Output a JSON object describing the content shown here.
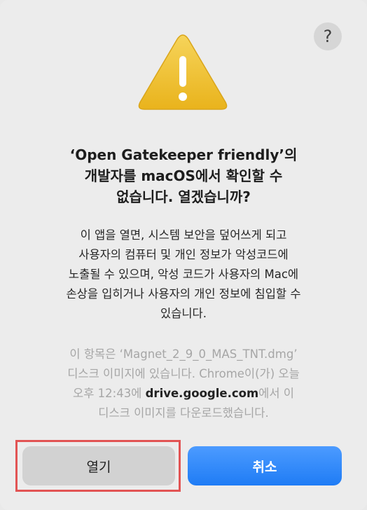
{
  "dialog": {
    "help_label": "?",
    "title_lines": [
      "‘Open Gatekeeper friendly’의",
      "개발자를 macOS에서 확인할 수",
      "없습니다. 열겠습니까?"
    ],
    "message_lines": [
      "이 앱을 열면, 시스템 보안을 덮어쓰게 되고",
      "사용자의 컴퓨터 및 개인 정보가 악성코드에",
      "노출될 수 있으며, 악성 코드가 사용자의 Mac에",
      "손상을 입히거나 사용자의 개인 정보에 침입할 수",
      "있습니다."
    ],
    "info_lines": [
      "이 항목은 ‘Magnet_2_9_0_MAS_TNT.dmg’",
      "디스크 이미지에 있습니다. Chrome이(가) 오늘"
    ],
    "info_line3_prefix": "오후 12:43에 ",
    "info_domain": "drive.google.com",
    "info_line3_suffix": "에서 이",
    "info_line4": "디스크 이미지를 다운로드했습니다.",
    "open_button_label": "열기",
    "cancel_button_label": "취소"
  },
  "icons": {
    "warning": "warning-triangle-icon",
    "help": "question-mark-icon"
  },
  "colors": {
    "accent": "#1f7cf5",
    "warning_yellow": "#f3c22f",
    "highlight_red": "#e25454"
  }
}
